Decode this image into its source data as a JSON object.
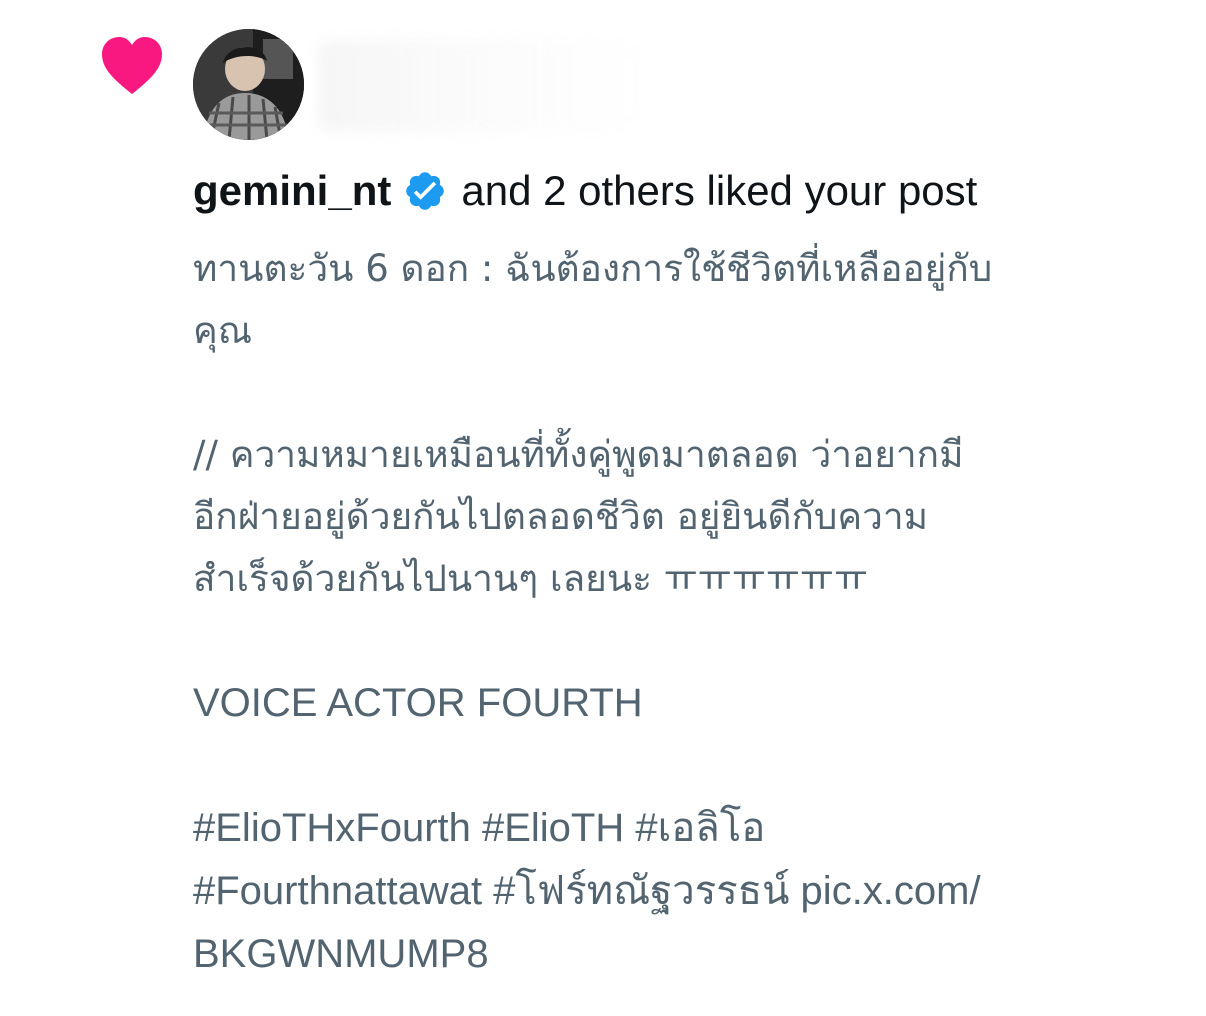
{
  "notification": {
    "type_icon": "heart-icon",
    "type_color": "#f91880",
    "avatar_icon": "avatar",
    "username": "gemini_nt",
    "verified_icon": "verified-badge-icon",
    "verified_color": "#1d9bf0",
    "action_text": "and 2 others liked your post"
  },
  "post": {
    "lines": [
      "ทานตะวัน 6 ดอก : ฉันต้องการใช้ชีวิตที่เหลืออยู่กับ",
      "คุณ",
      "",
      "// ความหมายเหมือนที่ทั้งคู่พูดมาตลอด ว่าอยากมี",
      "อีกฝ่ายอยู่ด้วยกันไปตลอดชีวิต อยู่ยินดีกับความ",
      "สำเร็จด้วยกันไปนานๆ เลยนะ ㅠㅠㅠㅠㅠㅠ",
      "",
      "VOICE ACTOR FOURTH",
      "",
      "#ElioTHxFourth #ElioTH #เอลิโอ",
      "#Fourthnattawat #โฟร์ทณัฐวรรธน์ pic.x.com/",
      "BKGWNMUMP8"
    ]
  },
  "colors": {
    "text_primary": "#0f1419",
    "text_secondary": "#536471",
    "background": "#ffffff"
  }
}
